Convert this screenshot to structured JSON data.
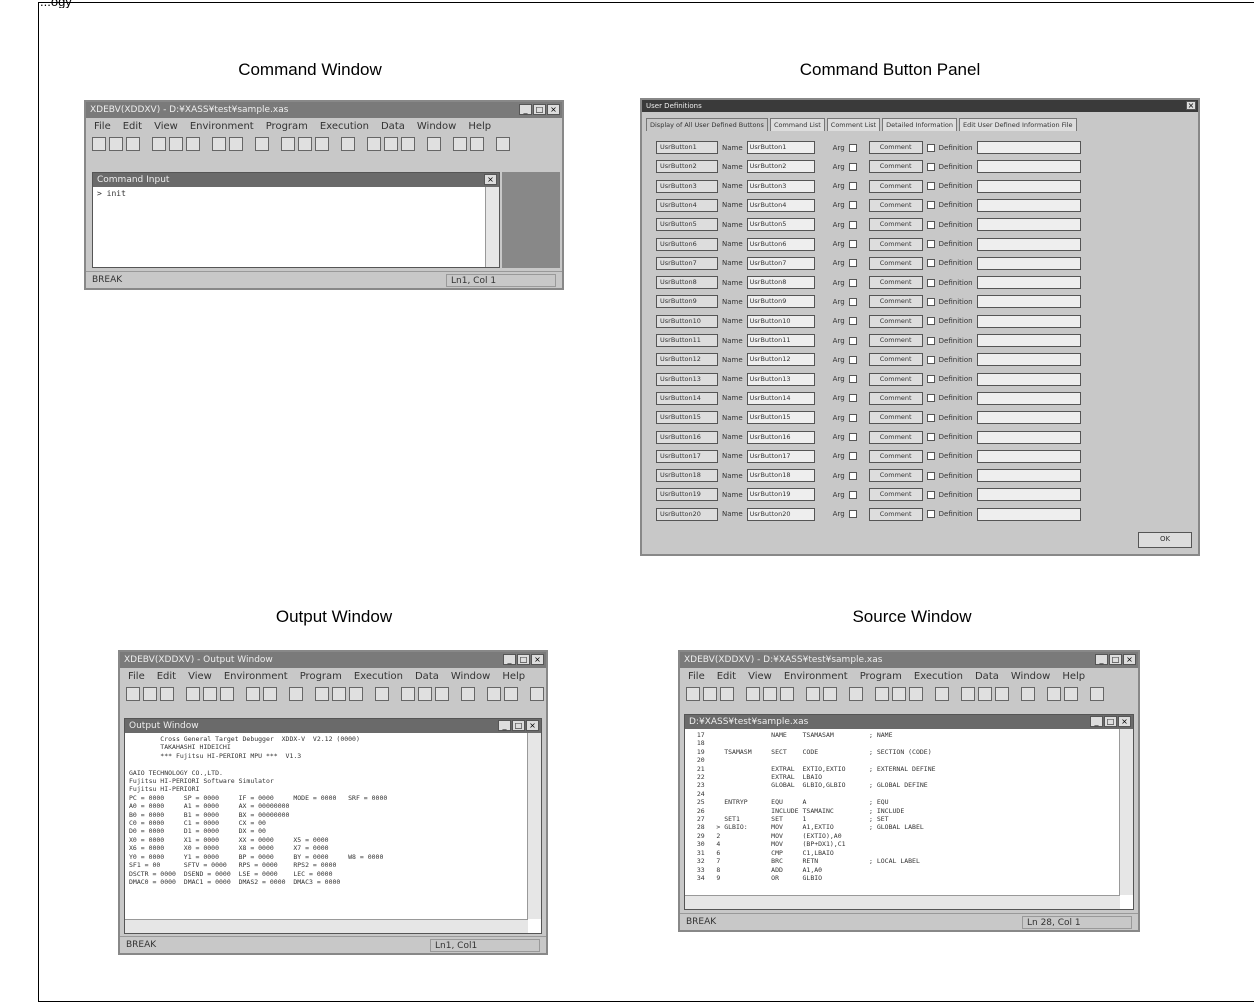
{
  "captions": {
    "command_window": "Command Window",
    "command_button_panel": "Command Button Panel",
    "output_window": "Output Window",
    "source_window": "Source Window"
  },
  "top_fragment": "...ogy",
  "menus": [
    "File",
    "Edit",
    "View",
    "Environment",
    "Program",
    "Execution",
    "Data",
    "Window",
    "Help"
  ],
  "command_window": {
    "title": "XDEBV(XDDXV) - D:¥XASS¥test¥sample.xas",
    "pane_title": "Command Input",
    "content": "> init",
    "status_left": "BREAK",
    "status_right": "Ln1, Col 1"
  },
  "button_panel": {
    "title": "User Definitions",
    "tabs": [
      "Display of All User Defined Buttons",
      "Command List",
      "Comment List",
      "Detailed Information",
      "Edit User Defined Information File"
    ],
    "rows": [
      {
        "button": "UsrButton1",
        "name": "UsrButton1"
      },
      {
        "button": "UsrButton2",
        "name": "UsrButton2"
      },
      {
        "button": "UsrButton3",
        "name": "UsrButton3"
      },
      {
        "button": "UsrButton4",
        "name": "UsrButton4"
      },
      {
        "button": "UsrButton5",
        "name": "UsrButton5"
      },
      {
        "button": "UsrButton6",
        "name": "UsrButton6"
      },
      {
        "button": "UsrButton7",
        "name": "UsrButton7"
      },
      {
        "button": "UsrButton8",
        "name": "UsrButton8"
      },
      {
        "button": "UsrButton9",
        "name": "UsrButton9"
      },
      {
        "button": "UsrButton10",
        "name": "UsrButton10"
      },
      {
        "button": "UsrButton11",
        "name": "UsrButton11"
      },
      {
        "button": "UsrButton12",
        "name": "UsrButton12"
      },
      {
        "button": "UsrButton13",
        "name": "UsrButton13"
      },
      {
        "button": "UsrButton14",
        "name": "UsrButton14"
      },
      {
        "button": "UsrButton15",
        "name": "UsrButton15"
      },
      {
        "button": "UsrButton16",
        "name": "UsrButton16"
      },
      {
        "button": "UsrButton17",
        "name": "UsrButton17"
      },
      {
        "button": "UsrButton18",
        "name": "UsrButton18"
      },
      {
        "button": "UsrButton19",
        "name": "UsrButton19"
      },
      {
        "button": "UsrButton20",
        "name": "UsrButton20"
      }
    ],
    "name_label": "Name",
    "arg_label": "Arg",
    "comment_label": "Comment",
    "definition_label": "Definition",
    "ok_label": "OK"
  },
  "output_window": {
    "title": "XDEBV(XDDXV) - Output Window",
    "pane_title": "Output Window",
    "content": "        Cross General Target Debugger  XDDX-V  V2.12 (0000)\n        TAKAHASHI HIDEICHI\n        *** Fujitsu HI-PERIORI MPU ***  V1.3\n\nGAIO TECHNOLOGY CO.,LTD.\nFujitsu HI-PERIORI Software Simulator\nFujitsu HI-PERIORI\nPC = 0000     SP = 0000     IF = 0000     MODE = 0000   SRF = 0000\nA0 = 0000     A1 = 0000     AX = 00000000\nB0 = 0000     B1 = 0000     BX = 00000000\nC0 = 0000     C1 = 0000     CX = 00\nD0 = 0000     D1 = 0000     DX = 00\nX0 = 0000     X1 = 0000     XX = 0000     X5 = 0000\nX6 = 0000     X0 = 0000     X8 = 0000     X7 = 0000\nY0 = 0000     Y1 = 0000     BP = 0000     BY = 0000     W8 = 0000\nSF1 = 00      SFTV = 0000   RPS = 0000    RPS2 = 0000\nDSCTR = 0000  DSEND = 0000  LSE = 0000    LEC = 0000\nDMAC0 = 0000  DMAC1 = 0000  DMAS2 = 0000  DMAC3 = 0000",
    "status_left": "BREAK",
    "status_right": "Ln1, Col1"
  },
  "source_window": {
    "title": "XDEBV(XDDXV) - D:¥XASS¥test¥sample.xas",
    "pane_title": "D:¥XASS¥test¥sample.xas",
    "content": "  17                 NAME    TSAMASAM         ; NAME\n  18\n  19     TSAMASM     SECT    CODE             ; SECTION (CODE)\n  20\n  21                 EXTRAL  EXTIO,EXTIO      ; EXTERNAL DEFINE\n  22                 EXTRAL  LBAIO\n  23                 GLOBAL  GLBIO,GLBIO      ; GLOBAL DEFINE\n  24\n  25     ENTRYP      EQU     A                ; EQU\n  26                 INCLUDE TSAMAINC         ; INCLUDE\n  27     SET1        SET     1                ; SET\n  28   > GLBIO:      MOV     A1,EXTIO         ; GLOBAL LABEL\n  29   2             MOV     (EXTIO),A0\n  30   4             MOV     (BP+DX1),C1\n  31   6             CMP     C1,LBAIO\n  32   7             BRC     RETN             ; LOCAL LABEL\n  33   8             ADD     A1,A0\n  34   9             OR      GLBIO",
    "status_left": "BREAK",
    "status_right": "Ln 28, Col 1"
  }
}
